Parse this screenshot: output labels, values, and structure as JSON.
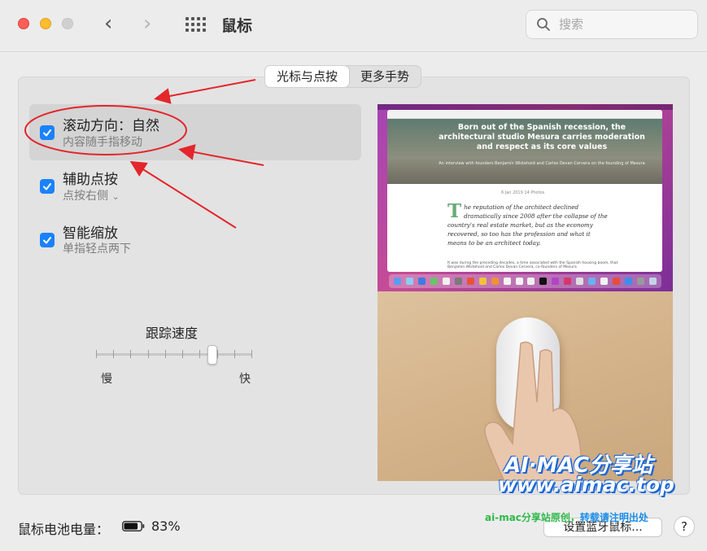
{
  "window": {
    "title": "鼠标",
    "search_placeholder": "搜索"
  },
  "tabs": [
    {
      "label": "光标与点按",
      "active": true
    },
    {
      "label": "更多手势",
      "active": false
    }
  ],
  "options": [
    {
      "title": "滚动方向：自然",
      "subtitle": "内容随手指移动",
      "checked": true,
      "selected": true
    },
    {
      "title": "辅助点按",
      "subtitle": "点按右侧",
      "checked": true,
      "selected": false
    },
    {
      "title": "智能缩放",
      "subtitle": "单指轻点两下",
      "checked": true,
      "selected": false
    }
  ],
  "tracking": {
    "title": "跟踪速度",
    "min_label": "慢",
    "max_label": "快",
    "level": 0.76
  },
  "preview": {
    "hero_headline": "Born out of the Spanish recession, the architectural studio Mesura carries moderation and respect as its core values",
    "hero_sub": "An interview with founders Benjamín Wistehoid and Carlos Devan Cervera on the founding of Mesura",
    "meta": "6 Jan 2019   14 Photos",
    "dropcap": "T",
    "article": "he reputation of the architect declined dramatically since 2008 after the collapse of the country's real estate market, but as the economy recovered, so too has the profession and what it means to be an architect today.",
    "article_foot": "It was during the preceding decades, a time associated with the Spanish housing boom, that Benjamín Wistehoid and Carlos Devan Cervera, co-founders of Mesura"
  },
  "watermark": {
    "line1": "AI·MAC分享站",
    "line2": "www.aimac.top",
    "line3_part1": "ai-mac分享站原创，",
    "line3_part2": "转载请注明出处"
  },
  "footer": {
    "battery_label": "鼠标电池电量：",
    "battery_percent": "83%",
    "battery_level": 0.83,
    "bluetooth_button": "设置蓝牙鼠标...",
    "help": "?"
  },
  "colors": {
    "accent": "#1a82fb",
    "annotation": "#e3262b"
  }
}
